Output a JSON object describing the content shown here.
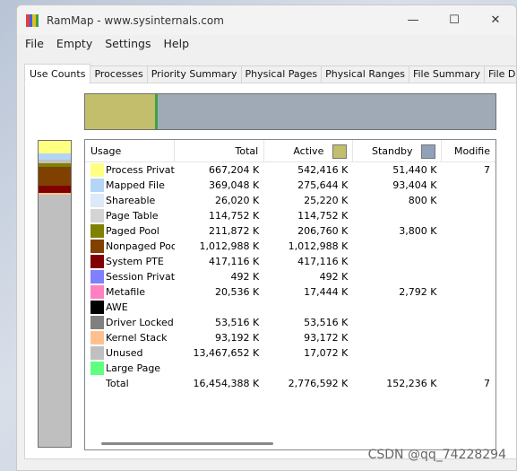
{
  "window": {
    "title": "RamMap - www.sysinternals.com"
  },
  "controls": {
    "minimize": "—",
    "maximize": "☐",
    "close": "✕"
  },
  "menu": [
    "File",
    "Empty",
    "Settings",
    "Help"
  ],
  "tabs": [
    "Use Counts",
    "Processes",
    "Priority Summary",
    "Physical Pages",
    "Physical Ranges",
    "File Summary",
    "File Details"
  ],
  "columns": {
    "usage": "Usage",
    "total": "Total",
    "active": "Active",
    "standby": "Standby",
    "modified": "Modifie"
  },
  "header_colors": {
    "active": "#c3be6c",
    "standby": "#8fa2b9"
  },
  "rows": [
    {
      "label": "Process Private",
      "color": "#ffff80",
      "total": "667,204 K",
      "active": "542,416 K",
      "standby": "51,440 K",
      "modified": "7"
    },
    {
      "label": "Mapped File",
      "color": "#b4d5f5",
      "total": "369,048 K",
      "active": "275,644 K",
      "standby": "93,404 K",
      "modified": ""
    },
    {
      "label": "Shareable",
      "color": "#dbe9f8",
      "total": "26,020 K",
      "active": "25,220 K",
      "standby": "800 K",
      "modified": ""
    },
    {
      "label": "Page Table",
      "color": "#d4d4d4",
      "total": "114,752 K",
      "active": "114,752 K",
      "standby": "",
      "modified": ""
    },
    {
      "label": "Paged Pool",
      "color": "#808000",
      "total": "211,872 K",
      "active": "206,760 K",
      "standby": "3,800 K",
      "modified": ""
    },
    {
      "label": "Nonpaged Pool",
      "color": "#804000",
      "total": "1,012,988 K",
      "active": "1,012,988 K",
      "standby": "",
      "modified": ""
    },
    {
      "label": "System PTE",
      "color": "#800000",
      "total": "417,116 K",
      "active": "417,116 K",
      "standby": "",
      "modified": ""
    },
    {
      "label": "Session Private",
      "color": "#8080ff",
      "total": "492 K",
      "active": "492 K",
      "standby": "",
      "modified": ""
    },
    {
      "label": "Metafile",
      "color": "#ff80c0",
      "total": "20,536 K",
      "active": "17,444 K",
      "standby": "2,792 K",
      "modified": ""
    },
    {
      "label": "AWE",
      "color": "#000000",
      "total": "",
      "active": "",
      "standby": "",
      "modified": ""
    },
    {
      "label": "Driver Locked",
      "color": "#808080",
      "total": "53,516 K",
      "active": "53,516 K",
      "standby": "",
      "modified": ""
    },
    {
      "label": "Kernel Stack",
      "color": "#ffc090",
      "total": "93,192 K",
      "active": "93,172 K",
      "standby": "",
      "modified": ""
    },
    {
      "label": "Unused",
      "color": "#c0c0c0",
      "total": "13,467,652 K",
      "active": "17,072 K",
      "standby": "",
      "modified": ""
    },
    {
      "label": "Large Page",
      "color": "#60ff80",
      "total": "",
      "active": "",
      "standby": "",
      "modified": ""
    },
    {
      "label": "Total",
      "color": "",
      "total": "16,454,388 K",
      "active": "2,776,592 K",
      "standby": "152,236 K",
      "modified": "7"
    }
  ],
  "usage_bar": [
    {
      "name": "active",
      "color": "#c3be6c",
      "fraction": 0.17
    },
    {
      "name": "transition",
      "color": "#3ea04a",
      "fraction": 0.007
    },
    {
      "name": "standby",
      "color": "#a0aab6",
      "fraction": 0.823
    }
  ],
  "usage_stack": [
    {
      "name": "process-private",
      "color": "#ffff80",
      "fraction": 0.04
    },
    {
      "name": "mapped-file",
      "color": "#b4d5f5",
      "fraction": 0.022
    },
    {
      "name": "page-table",
      "color": "#c0c0c0",
      "fraction": 0.01
    },
    {
      "name": "paged-pool",
      "color": "#808000",
      "fraction": 0.013
    },
    {
      "name": "nonpaged-pool",
      "color": "#804000",
      "fraction": 0.061
    },
    {
      "name": "system-pte",
      "color": "#800000",
      "fraction": 0.025
    },
    {
      "name": "kernel-stack",
      "color": "#ffc090",
      "fraction": 0.006
    },
    {
      "name": "unused",
      "color": "#bfbfbf",
      "fraction": 0.823
    }
  ],
  "watermark": "CSDN @qq_74228294"
}
